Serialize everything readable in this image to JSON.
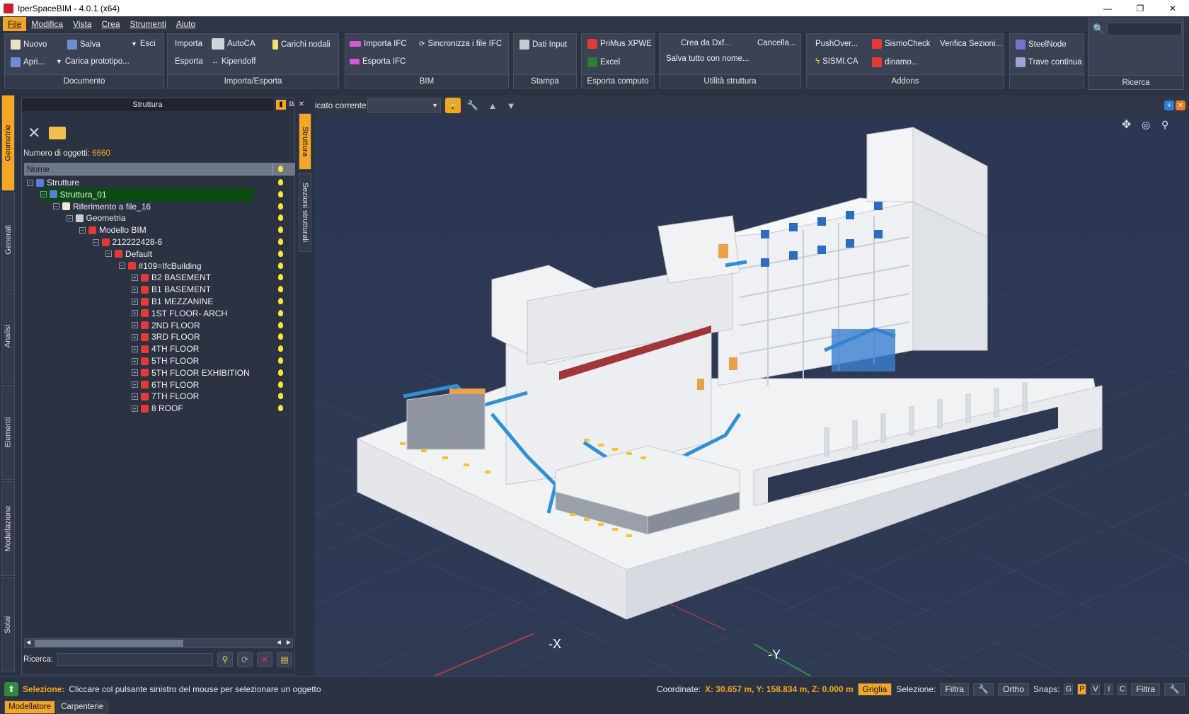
{
  "window": {
    "title": "IperSpaceBIM - 4.0.1 (x64)",
    "minimize": "—",
    "maximize": "❐",
    "close": "✕"
  },
  "menu": [
    "File",
    "Modifica",
    "Vista",
    "Crea",
    "Strumenti",
    "Aiuto"
  ],
  "ribbon": {
    "documento": {
      "caption": "Documento",
      "nuovo": "Nuovo",
      "salva": "Salva",
      "esci": "Esci",
      "apri": "Apri...",
      "carica": "Carica prototipo..."
    },
    "importa_esporta": {
      "caption": "Importa/Esporta",
      "importa": "Importa",
      "autoca": "AutoCA",
      "carichi": "Carichi nodali",
      "esporta": "Esporta",
      "kipendoff": "Kipendoff"
    },
    "bim": {
      "caption": "BIM",
      "importa_ifc": "Importa IFC",
      "sincronizza": "Sincronizza i file IFC",
      "esporta_ifc": "Esporta IFC"
    },
    "stampa": {
      "caption": "Stampa",
      "dati_input": "Dati Input"
    },
    "esporta_computo": {
      "caption": "Esporta computo",
      "primus": "PriMus XPWE",
      "excel": "Excel"
    },
    "utilita": {
      "caption": "Utilità struttura",
      "crea_dxf": "Crea da Dxf...",
      "cancella": "Cancella...",
      "salva_tutto": "Salva tutto con nome..."
    },
    "addons": {
      "caption": "Addons",
      "pushover": "PushOver...",
      "sismocheck": "SismoCheck",
      "verifica": "Verifica Sezioni...",
      "sismica": "SISMI.CA",
      "dinamo": "dinamo..."
    },
    "steel": {
      "steelnode": "SteelNode",
      "trave": "Trave continua"
    },
    "ricerca": {
      "caption": "Ricerca"
    }
  },
  "left_tabs": [
    "Geometrie",
    "Generali",
    "Analisi",
    "Elementi",
    "Modellazione",
    "Solai"
  ],
  "panel": {
    "title": "Struttura",
    "count_label": "Numero di oggetti:",
    "count_value": "6660",
    "column_name": "Nome",
    "search_label": "Ricerca:"
  },
  "tree": [
    {
      "label": "Strutture",
      "level": 0,
      "icon": "structure-icon"
    },
    {
      "label": "Struttura_01",
      "level": 1,
      "icon": "structure-icon",
      "selected": true
    },
    {
      "label": "Riferimento a file_16",
      "level": 2,
      "icon": "file-icon"
    },
    {
      "label": "Geometria",
      "level": 3,
      "icon": "geometry-icon"
    },
    {
      "label": "Modello BIM",
      "level": 4,
      "icon": "bim-icon"
    },
    {
      "label": "212222428-6",
      "level": 5,
      "icon": "bim-icon"
    },
    {
      "label": "Default",
      "level": 6,
      "icon": "bim-icon"
    },
    {
      "label": "#109=IfcBuilding",
      "level": 7,
      "icon": "bim-icon"
    },
    {
      "label": "B2  BASEMENT",
      "level": 8,
      "icon": "bim-icon"
    },
    {
      "label": "B1 BASEMENT",
      "level": 8,
      "icon": "bim-icon"
    },
    {
      "label": "B1 MEZZANINE",
      "level": 8,
      "icon": "bim-icon"
    },
    {
      "label": "1ST FLOOR- ARCH",
      "level": 8,
      "icon": "bim-icon"
    },
    {
      "label": "2ND FLOOR",
      "level": 8,
      "icon": "bim-icon"
    },
    {
      "label": "3RD FLOOR",
      "level": 8,
      "icon": "bim-icon"
    },
    {
      "label": "4TH FLOOR",
      "level": 8,
      "icon": "bim-icon"
    },
    {
      "label": "5TH FLOOR",
      "level": 8,
      "icon": "bim-icon"
    },
    {
      "label": "5TH FLOOR EXHIBITION",
      "level": 8,
      "icon": "bim-icon"
    },
    {
      "label": "6TH FLOOR",
      "level": 8,
      "icon": "bim-icon"
    },
    {
      "label": "7TH FLOOR",
      "level": 8,
      "icon": "bim-icon"
    },
    {
      "label": "8 ROOF",
      "level": 8,
      "icon": "bim-icon"
    }
  ],
  "side_tabs": [
    "Struttura",
    "Sezioni strutturali"
  ],
  "viewport_toolbar": {
    "label": "icato corrente:",
    "combo_value": ""
  },
  "axes": {
    "x": "-X",
    "y": "-Y"
  },
  "status": {
    "selection_label": "Selezione:",
    "selection_text": "Cliccare col pulsante sinistro del mouse per selezionare un oggetto",
    "coord_label": "Coordinate:",
    "coord_value": "X: 30.657 m, Y: 158.834 m, Z: 0.000 m",
    "griglia": "Griglia",
    "selezione_label": "Selezione:",
    "filtra": "Filtra",
    "ortho": "Ortho",
    "snaps_label": "Snaps:",
    "snaps": [
      "G",
      "P",
      "V",
      "I",
      "C"
    ],
    "filtra2": "Filtra"
  },
  "bottom_tabs": [
    "Modellatore",
    "Carpenterie"
  ],
  "colors": {
    "accent": "#f5a623",
    "background": "#2b3242",
    "viewport": "#2f3a52",
    "selected_row": "#0a4b0f"
  }
}
